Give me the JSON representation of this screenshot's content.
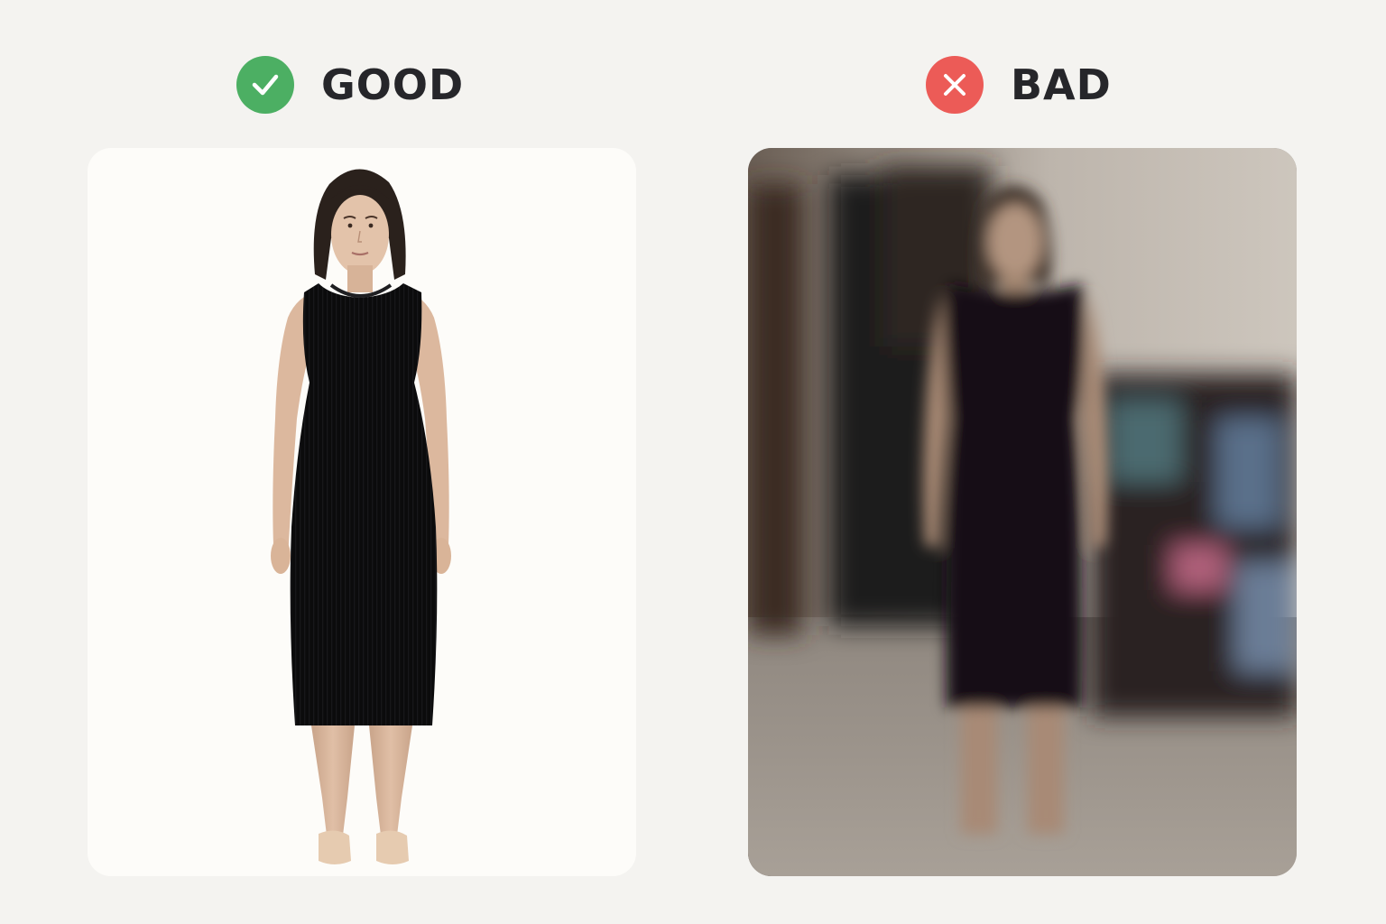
{
  "good": {
    "label": "GOOD",
    "badge_color": "#4caf63",
    "icon": "check-icon"
  },
  "bad": {
    "label": "BAD",
    "badge_color": "#ec5b57",
    "icon": "close-icon"
  }
}
